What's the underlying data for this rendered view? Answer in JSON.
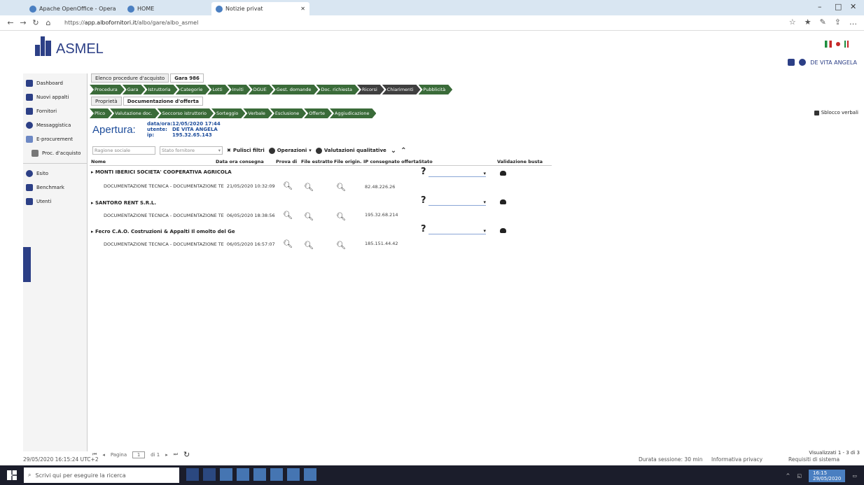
{
  "browser": {
    "tabs": [
      {
        "label": "Apache OpenOffice - Opera"
      },
      {
        "label": "HOME"
      },
      {
        "label": "Notizie privat"
      }
    ],
    "url_prefix": "https://",
    "url_host": "app.albofornitori.it",
    "url_path": "/albo/gare/albo_asmel"
  },
  "header": {
    "logo_text": "ASMEL",
    "user_name": "DE VITA ANGELA"
  },
  "sidebar": {
    "items": [
      {
        "label": "Dashboard"
      },
      {
        "label": "Nuovi appalti"
      },
      {
        "label": "Fornitori"
      },
      {
        "label": "Messaggistica"
      },
      {
        "label": "E-procurement"
      },
      {
        "label": "Proc. d'acquisto"
      },
      {
        "label": "Esito"
      },
      {
        "label": "Benchmark"
      },
      {
        "label": "Utenti"
      }
    ]
  },
  "main": {
    "top_tabs": [
      {
        "label": "Elenco procedure d'acquisto"
      },
      {
        "label": "Gara 986"
      }
    ],
    "steps_row1": [
      {
        "label": "Procedura"
      },
      {
        "label": "Gara"
      },
      {
        "label": "Istruttoria"
      },
      {
        "label": "Categorie"
      },
      {
        "label": "Lotti"
      },
      {
        "label": "Inviti"
      },
      {
        "label": "DGUE"
      },
      {
        "label": "Gest. domande"
      },
      {
        "label": "Doc. richiesta"
      },
      {
        "label": "Ricorsi"
      },
      {
        "label": "Chiarimenti"
      },
      {
        "label": "Pubblicità"
      }
    ],
    "sub_tabs": [
      {
        "label": "Proprietà"
      },
      {
        "label": "Documentazione d'offerta"
      }
    ],
    "steps_row2": [
      {
        "label": "Plico"
      },
      {
        "label": "Valutazione doc."
      },
      {
        "label": "Soccorso istruttorio"
      },
      {
        "label": "Sorteggio"
      },
      {
        "label": "Verbale"
      },
      {
        "label": "Esclusione"
      },
      {
        "label": "Offerte"
      },
      {
        "label": "Aggiudicazione"
      }
    ],
    "right_link": "Sblocco verbali",
    "apertura_title": "Apertura:",
    "meta": {
      "datetime_label": "data/ora:",
      "datetime_value": "12/05/2020 17:44",
      "user_label": "utente:",
      "user_value": "DE VITA ANGELA",
      "ip_label": "ip:",
      "ip_value": "195.32.65.143"
    },
    "filters": {
      "ragione_sociale_placeholder": "Ragione sociale",
      "stato_placeholder": "Stato fornitore",
      "pulisci_label": "Pulisci filtri",
      "operazioni_label": "Operazioni",
      "valutazioni_label": "Valutazioni qualitative"
    },
    "columns": [
      "Nome",
      "Data ora consegna",
      "Prova di",
      "File estratto",
      "File origin.",
      "IP consegnato offerta",
      "Stato",
      "Validazione busta"
    ],
    "groups": [
      {
        "name": "MONTI IBERICI SOCIETA' COOPERATIVA AGRICOLA",
        "doc": "DOCUMENTAZIONE TECNICA - DOCUMENTAZIONE TE",
        "date": "21/05/2020 10:32:09",
        "ip": "82.48.226.26"
      },
      {
        "name": "SANTORO RENT S.R.L.",
        "doc": "DOCUMENTAZIONE TECNICA - DOCUMENTAZIONE TE",
        "date": "06/05/2020 18:38:56",
        "ip": "195.32.68.214"
      },
      {
        "name": "Fecro C.A.O. Costruzioni & Appalti Il omolto del Ge",
        "doc": "DOCUMENTAZIONE TECNICA - DOCUMENTAZIONE TE",
        "date": "06/05/2020 16:57:07",
        "ip": "185.151.44.42"
      }
    ],
    "pager": {
      "page_label": "Pagina",
      "page_value": "1",
      "of_label": "di 1",
      "count_label": "Visualizzati 1 - 3 di 3"
    }
  },
  "status": {
    "left_timestamp": "29/05/2020 16:15:24 UTC+2",
    "session": "Durata sessione: 30 min",
    "privacy": "Informativa privacy",
    "requisiti": "Requisiti di sistema"
  },
  "taskbar": {
    "search_placeholder": "Scrivi qui per eseguire la ricerca",
    "clock_time": "16:15",
    "clock_date": "29/05/2020"
  }
}
